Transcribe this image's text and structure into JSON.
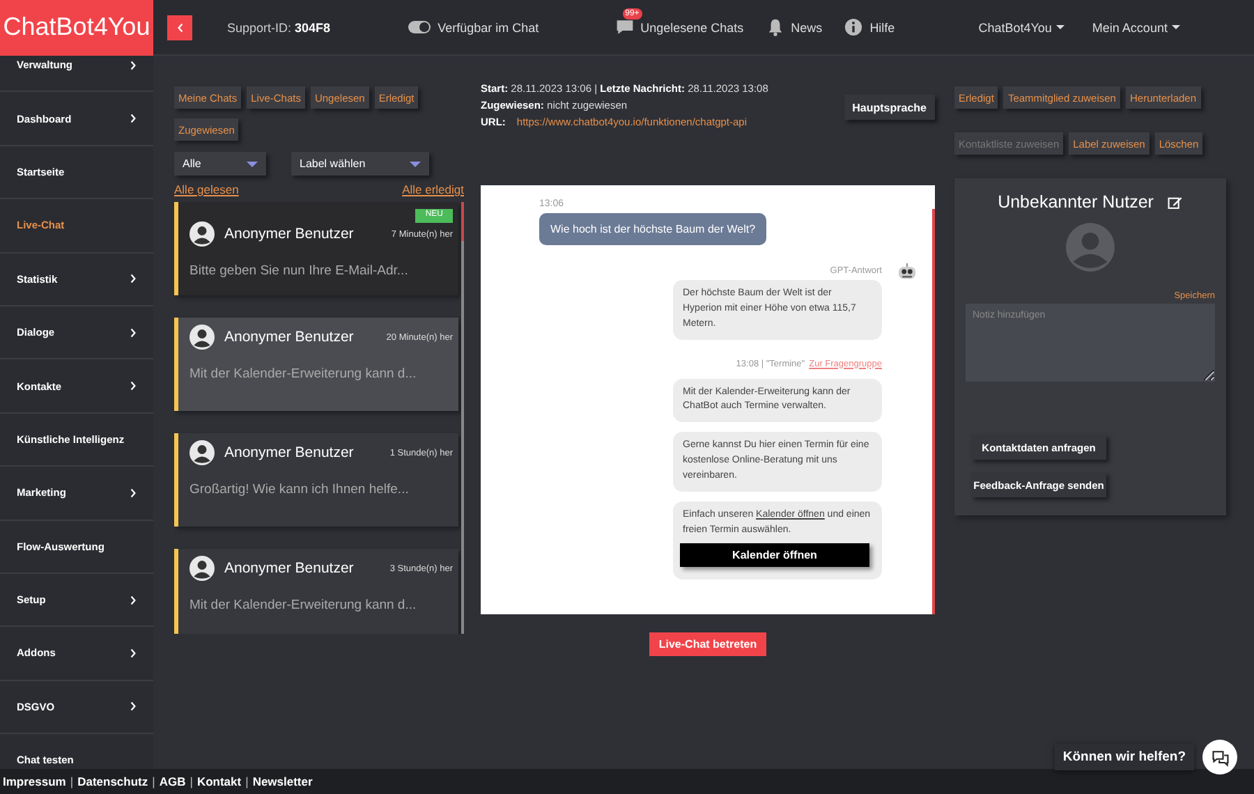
{
  "app": {
    "logo": "ChatBot4You"
  },
  "topbar": {
    "support_id": "Support-ID: **304F8**",
    "availability": {
      "label": "Verfügbar im Chat",
      "on": true
    },
    "unread": {
      "badge": "99+",
      "label": "Ungelesene Chats"
    },
    "news": "News",
    "help": "Hilfe",
    "menus": [
      "ChatBot4You",
      "Mein Account"
    ]
  },
  "sidebar": {
    "items": [
      {
        "label": "Verwaltung",
        "expandable": true,
        "selected": false
      },
      {
        "label": "Dashboard",
        "expandable": true,
        "selected": false
      },
      {
        "label": "Startseite",
        "expandable": false,
        "selected": false
      },
      {
        "label": "Live-Chat",
        "expandable": false,
        "selected": true
      },
      {
        "label": "Statistik",
        "expandable": true,
        "selected": false
      },
      {
        "label": "Dialoge",
        "expandable": true,
        "selected": false
      },
      {
        "label": "Kontakte",
        "expandable": true,
        "selected": false
      },
      {
        "label": "Künstliche Intelligenz",
        "expandable": false,
        "selected": false
      },
      {
        "label": "Marketing",
        "expandable": true,
        "selected": false
      },
      {
        "label": "Flow-Auswertung",
        "expandable": false,
        "selected": false
      },
      {
        "label": "Setup",
        "expandable": true,
        "selected": false
      },
      {
        "label": "Addons",
        "expandable": true,
        "selected": false
      },
      {
        "label": "DSGVO",
        "expandable": true,
        "selected": false
      },
      {
        "label": "Chat testen",
        "expandable": false,
        "selected": false
      }
    ]
  },
  "chat_list": {
    "filters": [
      "Meine Chats",
      "Live-Chats",
      "Ungelesen",
      "Erledigt",
      "Zugewiesen"
    ],
    "dropdowns": [
      "Alle",
      "Label wählen"
    ],
    "mark_all_read": "Alle gelesen",
    "mark_all_done": "Alle erledigt",
    "chats": [
      {
        "name": "Anonymer Benutzer",
        "time": "7 Minute(n) her",
        "preview": "Bitte geben Sie nun Ihre E-Mail-Adr...",
        "badge": "NEU",
        "unread": true,
        "selected": false
      },
      {
        "name": "Anonymer Benutzer",
        "time": "20 Minute(n) her",
        "preview": "Mit der Kalender-Erweiterung kann d...",
        "unread": false,
        "selected": true
      },
      {
        "name": "Anonymer Benutzer",
        "time": "1 Stunde(n) her",
        "preview": "Großartig! Wie kann ich Ihnen helfe...",
        "unread": false,
        "selected": false
      },
      {
        "name": "Anonymer Benutzer",
        "time": "3 Stunde(n) her",
        "preview": "Mit der Kalender-Erweiterung kann d...",
        "unread": false,
        "selected": false
      }
    ]
  },
  "conversation": {
    "info": [
      "**Start:** 28.11.2023 13:06  |  **Letzte Nachricht:** 28.11.2023 13:08",
      "**Zugewiesen:** nicht zugewiesen"
    ],
    "url": {
      "label": "URL:",
      "link": "https://www.chatbot4you.io/funktionen/chatgpt-api"
    },
    "language_button": "Hauptsprache",
    "messages": [
      {
        "kind": "user",
        "time": "13:06",
        "text": "Wie hoch ist der höchste Baum der Welt?"
      },
      {
        "kind": "bot",
        "sender": "GPT-Antwort",
        "text": "Der höchste Baum der Welt ist der Hyperion mit einer Höhe von etwa 115,7 Metern."
      },
      {
        "kind": "meta",
        "text": "13:08 | \"Termine\"",
        "link": "Zur Fragengruppe"
      },
      {
        "kind": "bot",
        "text": "Mit der Kalender-Erweiterung kann der ChatBot auch Termine verwalten."
      },
      {
        "kind": "bot",
        "text": "Gerne kannst Du hier einen Termin für eine kostenlose Online-Beratung mit uns vereinbaren."
      },
      {
        "kind": "bot_link",
        "text_before": "Einfach unseren",
        "link": "Kalender öffnen",
        "text_after": "und einen freien Termin auswählen.",
        "button": "Kalender öffnen"
      }
    ],
    "join_button": "Live-Chat betreten"
  },
  "contact": {
    "actions": [
      [
        {
          "label": "Erledigt",
          "disabled": false
        },
        {
          "label": "Teammitglied zuweisen",
          "disabled": false
        },
        {
          "label": "Herunterladen",
          "disabled": false
        }
      ],
      [
        {
          "label": "Kontaktliste zuweisen",
          "disabled": true
        },
        {
          "label": "Label zuweisen",
          "disabled": false
        },
        {
          "label": "Löschen",
          "disabled": false
        }
      ]
    ],
    "name": "Unbekannter Nutzer",
    "save": "Speichern",
    "note_placeholder": "Notiz hinzufügen",
    "buttons": [
      "Kontaktdaten anfragen",
      "Feedback-Anfrage senden"
    ]
  },
  "footer": [
    {
      "kind": "link",
      "text": "Impressum"
    },
    {
      "kind": "sep",
      "text": "|"
    },
    {
      "kind": "link",
      "text": "Datenschutz"
    },
    {
      "kind": "sep",
      "text": "|"
    },
    {
      "kind": "link",
      "text": "AGB"
    },
    {
      "kind": "sep",
      "text": "|"
    },
    {
      "kind": "link",
      "text": "Kontakt"
    },
    {
      "kind": "sep",
      "text": "|"
    },
    {
      "kind": "link",
      "text": "Newsletter"
    }
  ],
  "help_widget": {
    "label": "Können wir helfen?"
  }
}
